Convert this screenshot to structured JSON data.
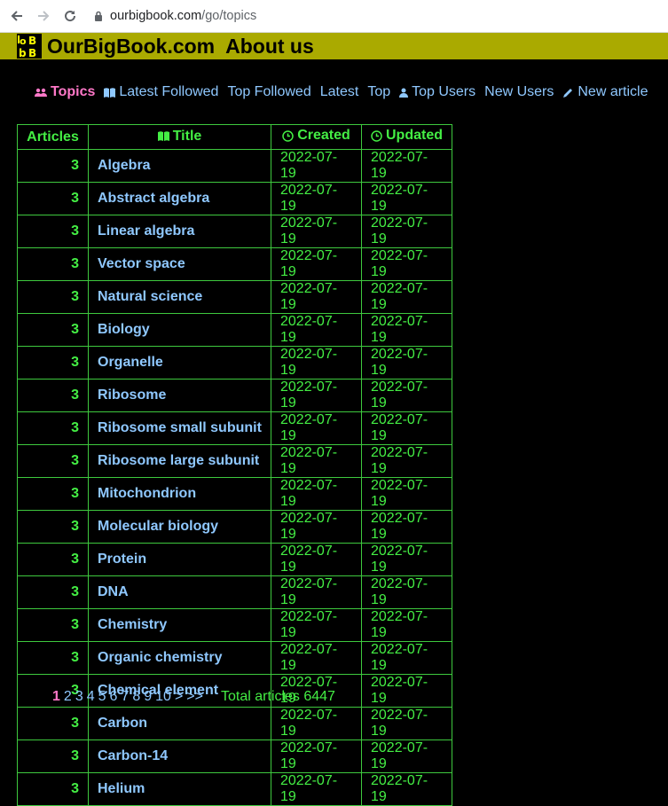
{
  "browser": {
    "url_host": "ourbigbook.com",
    "url_path": "/go/topics"
  },
  "header": {
    "site_name": "OurBigBook.com",
    "about": "About us",
    "brand_color": "#aaaa00"
  },
  "nav": [
    {
      "label": "Topics",
      "icon": "users-icon",
      "active": true
    },
    {
      "label": "Latest Followed",
      "icon": "book-icon",
      "active": false
    },
    {
      "label": "Top Followed",
      "icon": "",
      "active": false
    },
    {
      "label": "Latest",
      "icon": "",
      "active": false
    },
    {
      "label": "Top",
      "icon": "",
      "active": false
    },
    {
      "label": "Top Users",
      "icon": "user-icon",
      "active": false
    },
    {
      "label": "New Users",
      "icon": "",
      "active": false
    },
    {
      "label": "New article",
      "icon": "pencil-icon",
      "active": false
    }
  ],
  "table": {
    "headers": {
      "articles": "Articles",
      "title": "Title",
      "created": "Created",
      "updated": "Updated"
    },
    "rows": [
      {
        "count": "3",
        "title": "Algebra",
        "created": "2022-07-19",
        "updated": "2022-07-19"
      },
      {
        "count": "3",
        "title": "Abstract algebra",
        "created": "2022-07-19",
        "updated": "2022-07-19"
      },
      {
        "count": "3",
        "title": "Linear algebra",
        "created": "2022-07-19",
        "updated": "2022-07-19"
      },
      {
        "count": "3",
        "title": "Vector space",
        "created": "2022-07-19",
        "updated": "2022-07-19"
      },
      {
        "count": "3",
        "title": "Natural science",
        "created": "2022-07-19",
        "updated": "2022-07-19"
      },
      {
        "count": "3",
        "title": "Biology",
        "created": "2022-07-19",
        "updated": "2022-07-19"
      },
      {
        "count": "3",
        "title": "Organelle",
        "created": "2022-07-19",
        "updated": "2022-07-19"
      },
      {
        "count": "3",
        "title": "Ribosome",
        "created": "2022-07-19",
        "updated": "2022-07-19"
      },
      {
        "count": "3",
        "title": "Ribosome small subunit",
        "created": "2022-07-19",
        "updated": "2022-07-19"
      },
      {
        "count": "3",
        "title": "Ribosome large subunit",
        "created": "2022-07-19",
        "updated": "2022-07-19"
      },
      {
        "count": "3",
        "title": "Mitochondrion",
        "created": "2022-07-19",
        "updated": "2022-07-19"
      },
      {
        "count": "3",
        "title": "Molecular biology",
        "created": "2022-07-19",
        "updated": "2022-07-19"
      },
      {
        "count": "3",
        "title": "Protein",
        "created": "2022-07-19",
        "updated": "2022-07-19"
      },
      {
        "count": "3",
        "title": "DNA",
        "created": "2022-07-19",
        "updated": "2022-07-19"
      },
      {
        "count": "3",
        "title": "Chemistry",
        "created": "2022-07-19",
        "updated": "2022-07-19"
      },
      {
        "count": "3",
        "title": "Organic chemistry",
        "created": "2022-07-19",
        "updated": "2022-07-19"
      },
      {
        "count": "3",
        "title": "Chemical element",
        "created": "2022-07-19",
        "updated": "2022-07-19"
      },
      {
        "count": "3",
        "title": "Carbon",
        "created": "2022-07-19",
        "updated": "2022-07-19"
      },
      {
        "count": "3",
        "title": "Carbon-14",
        "created": "2022-07-19",
        "updated": "2022-07-19"
      },
      {
        "count": "3",
        "title": "Helium",
        "created": "2022-07-19",
        "updated": "2022-07-19"
      }
    ]
  },
  "pagination": {
    "pages": [
      "1",
      "2",
      "3",
      "4",
      "5",
      "6",
      "7",
      "8",
      "9",
      "10"
    ],
    "current": "1",
    "next": ">",
    "last": ">>",
    "total_label": "Total articles 6447"
  },
  "colors": {
    "link": "#8fc8ff",
    "active": "#ff78c8",
    "green": "#44ee44",
    "border": "#3ec93e"
  }
}
